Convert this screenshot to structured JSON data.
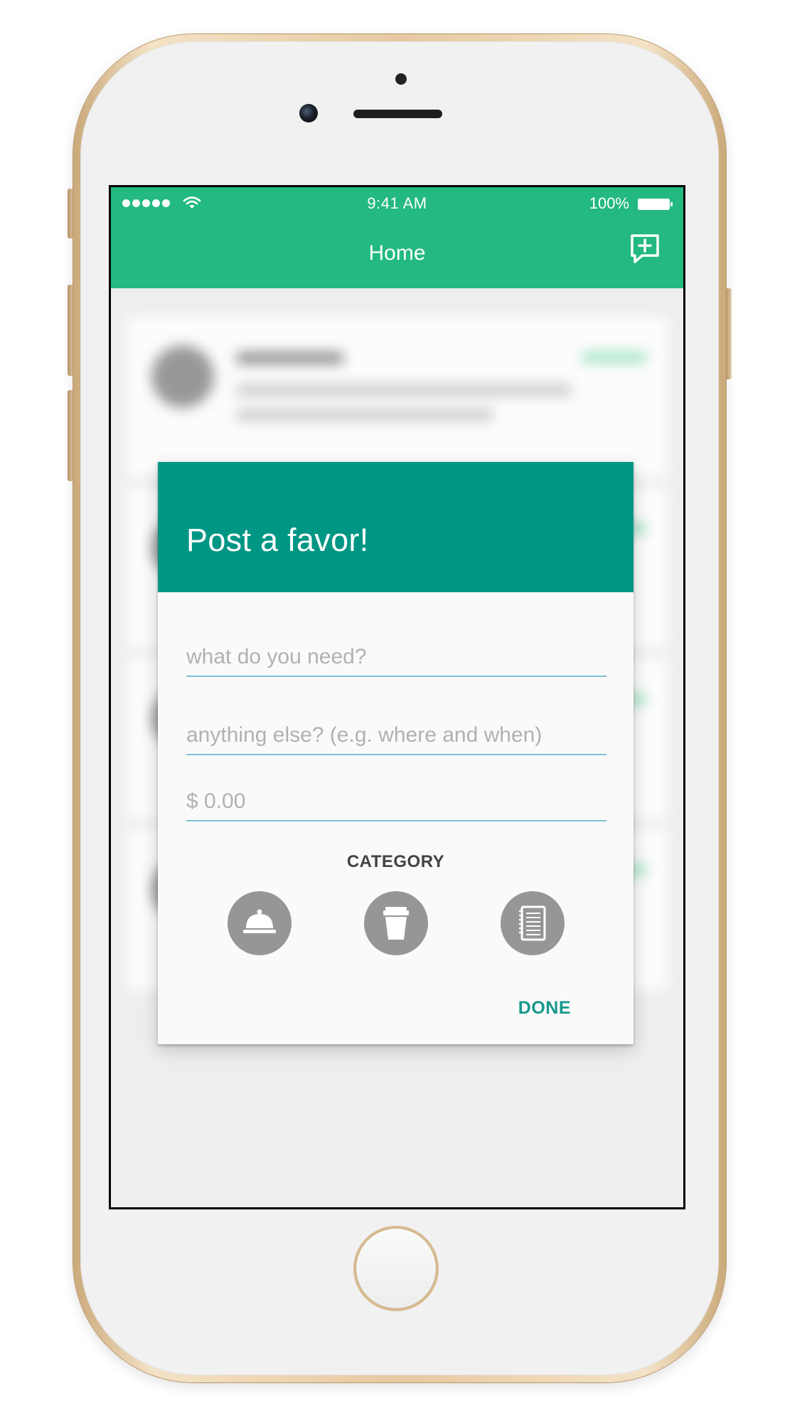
{
  "status_bar": {
    "time": "9:41 AM",
    "battery": "100%",
    "signal_icon": "signal-dots-icon",
    "wifi_icon": "wifi-icon",
    "battery_icon": "battery-icon"
  },
  "app_bar": {
    "title": "Home",
    "action_icon": "new-post-icon",
    "color": "#23b981"
  },
  "dialog": {
    "title": "Post a favor!",
    "header_color": "#009684",
    "fields": {
      "need": {
        "value": "",
        "placeholder": "what do you need?"
      },
      "details": {
        "value": "",
        "placeholder": "anything else? (e.g. where and when)"
      },
      "price": {
        "value": "",
        "placeholder": "$ 0.00"
      }
    },
    "category_label": "CATEGORY",
    "categories": [
      {
        "icon": "service-bell-icon"
      },
      {
        "icon": "coffee-cup-icon"
      },
      {
        "icon": "notebook-icon"
      }
    ],
    "done_label": "DONE",
    "accent_color": "#16988a"
  }
}
